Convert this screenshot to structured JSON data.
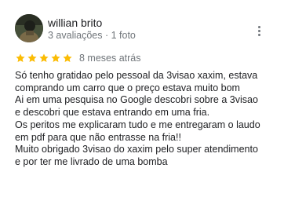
{
  "review": {
    "author_name": "willian brito",
    "author_meta": "3 avaliações · 1 foto",
    "rating": 5,
    "rating_max": 5,
    "time_ago": "8 meses atrás",
    "star_color": "#fbbc04",
    "lines": [
      "Só tenho gratidao pelo pessoal da 3visao xaxim, estava",
      "comprando um carro que o preço estava muito bom",
      "Ai em uma pesquisa no Google descobri sobre a 3visao",
      "e descobri que estava entrando em uma fria.",
      "Os peritos me explicaram tudo e me entregaram o laudo",
      "em pdf para que não entrasse na fria!!",
      "Muito obrigado 3visao do xaxim pelo super atendimento",
      "e por ter me livrado de uma bomba"
    ]
  },
  "icons": {
    "avatar": "avatar-photo",
    "menu": "more-vert-icon",
    "star": "star-icon"
  }
}
